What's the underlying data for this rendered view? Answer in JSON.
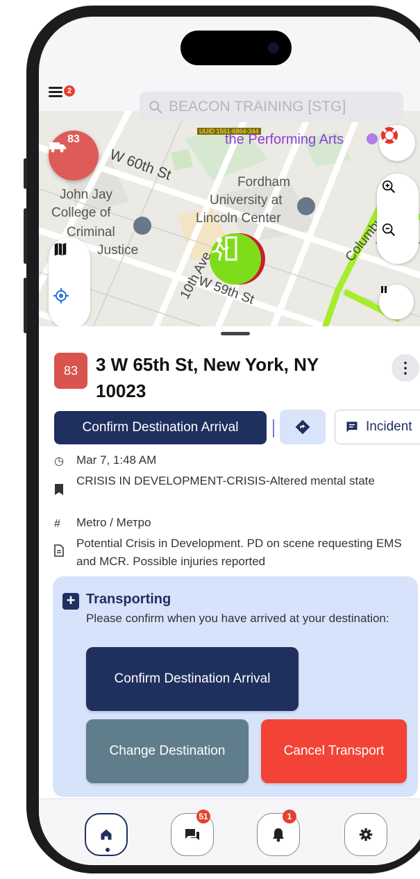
{
  "top_bar": {
    "menu_badge": "2",
    "search_placeholder": "BEACON TRAINING [STG]"
  },
  "map": {
    "uuid_tag": "UUID 1561-6864-344",
    "labels": {
      "performing_arts": "the Performing Arts",
      "w60": "W 60th St",
      "john_jay_1": "John Jay",
      "john_jay_2": "College of",
      "john_jay_3": "Criminal",
      "john_jay_4": "Justice",
      "fordham_1": "Fordham",
      "fordham_2": "University at",
      "fordham_3": "Lincoln Center",
      "tenth_ave": "10th Ave",
      "w59": "W 59th St",
      "columbus": "Columbus"
    },
    "unit_badge_number": "83"
  },
  "incident": {
    "unit_number": "83",
    "address": "3 W 65th St, New York, NY 10023",
    "confirm_arrival_label": "Confirm Destination Arrival",
    "incident_button_label": "Incident",
    "time": "Mar 7, 1:48 AM",
    "type": "CRISIS IN DEVELOPMENT-CRISIS-Altered mental state",
    "zone": "Metro / Метро",
    "notes": "Potential Crisis in Development. PD on scene requesting EMS and MCR. Possible injuries reported"
  },
  "transport_card": {
    "title": "Transporting",
    "subtitle": "Please confirm when you have arrived at your destination:",
    "confirm_label": "Confirm Destination Arrival",
    "change_label": "Change Destination",
    "cancel_label": "Cancel Transport"
  },
  "tab_bar": {
    "messages_badge": "51",
    "alerts_badge": "1"
  },
  "colors": {
    "primary": "#1f2f5e",
    "cancel": "#f34336",
    "change": "#607d8b",
    "card_bg": "#d7e2fb",
    "unit_badge": "#d9534f"
  }
}
